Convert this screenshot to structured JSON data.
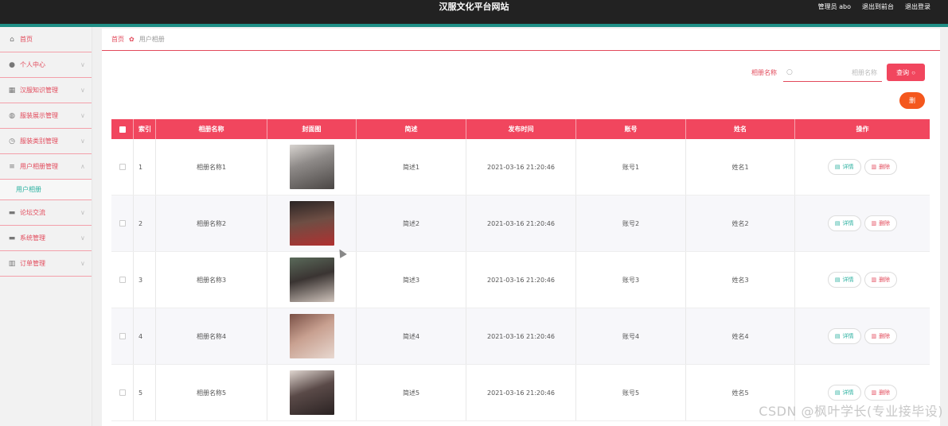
{
  "header": {
    "title": "汉服文化平台网站",
    "admin_label": "管理员 abo",
    "to_front": "退出到前台",
    "logout": "退出登录"
  },
  "sidebar": {
    "items": [
      {
        "label": "首页",
        "icon": "home-icon"
      },
      {
        "label": "个人中心",
        "icon": "user-icon"
      },
      {
        "label": "汉服知识管理",
        "icon": "grid-icon"
      },
      {
        "label": "服装展示管理",
        "icon": "globe-icon"
      },
      {
        "label": "服装类别管理",
        "icon": "clock-icon"
      },
      {
        "label": "用户相册管理",
        "icon": "menu-icon"
      },
      {
        "label": "论坛交流",
        "icon": "message-icon"
      },
      {
        "label": "系统管理",
        "icon": "settings-icon"
      },
      {
        "label": "订单管理",
        "icon": "chart-icon"
      }
    ],
    "sub_item": "用户相册"
  },
  "breadcrumb": {
    "home": "首页",
    "current": "用户相册"
  },
  "search": {
    "label": "相册名称",
    "placeholder": "相册名称",
    "query_label": "查询"
  },
  "delete_label": "删",
  "table": {
    "headers": [
      "索引",
      "相册名称",
      "封面图",
      "简述",
      "发布时间",
      "账号",
      "姓名",
      "操作"
    ],
    "rows": [
      {
        "index": "1",
        "name": "相册名称1",
        "desc": "简述1",
        "time": "2021-03-16 21:20:46",
        "account": "账号1",
        "person": "姓名1"
      },
      {
        "index": "2",
        "name": "相册名称2",
        "desc": "简述2",
        "time": "2021-03-16 21:20:46",
        "account": "账号2",
        "person": "姓名2"
      },
      {
        "index": "3",
        "name": "相册名称3",
        "desc": "简述3",
        "time": "2021-03-16 21:20:46",
        "account": "账号3",
        "person": "姓名3"
      },
      {
        "index": "4",
        "name": "相册名称4",
        "desc": "简述4",
        "time": "2021-03-16 21:20:46",
        "account": "账号4",
        "person": "姓名4"
      },
      {
        "index": "5",
        "name": "相册名称5",
        "desc": "简述5",
        "time": "2021-03-16 21:20:46",
        "account": "账号5",
        "person": "姓名5"
      }
    ],
    "detail_label": "详情",
    "delete_label": "删除"
  },
  "watermark": "CSDN @枫叶学长(专业接毕设)",
  "colors": {
    "accent": "#f1465e",
    "teal": "#1f8f86",
    "delete_orange": "#f4571d"
  }
}
